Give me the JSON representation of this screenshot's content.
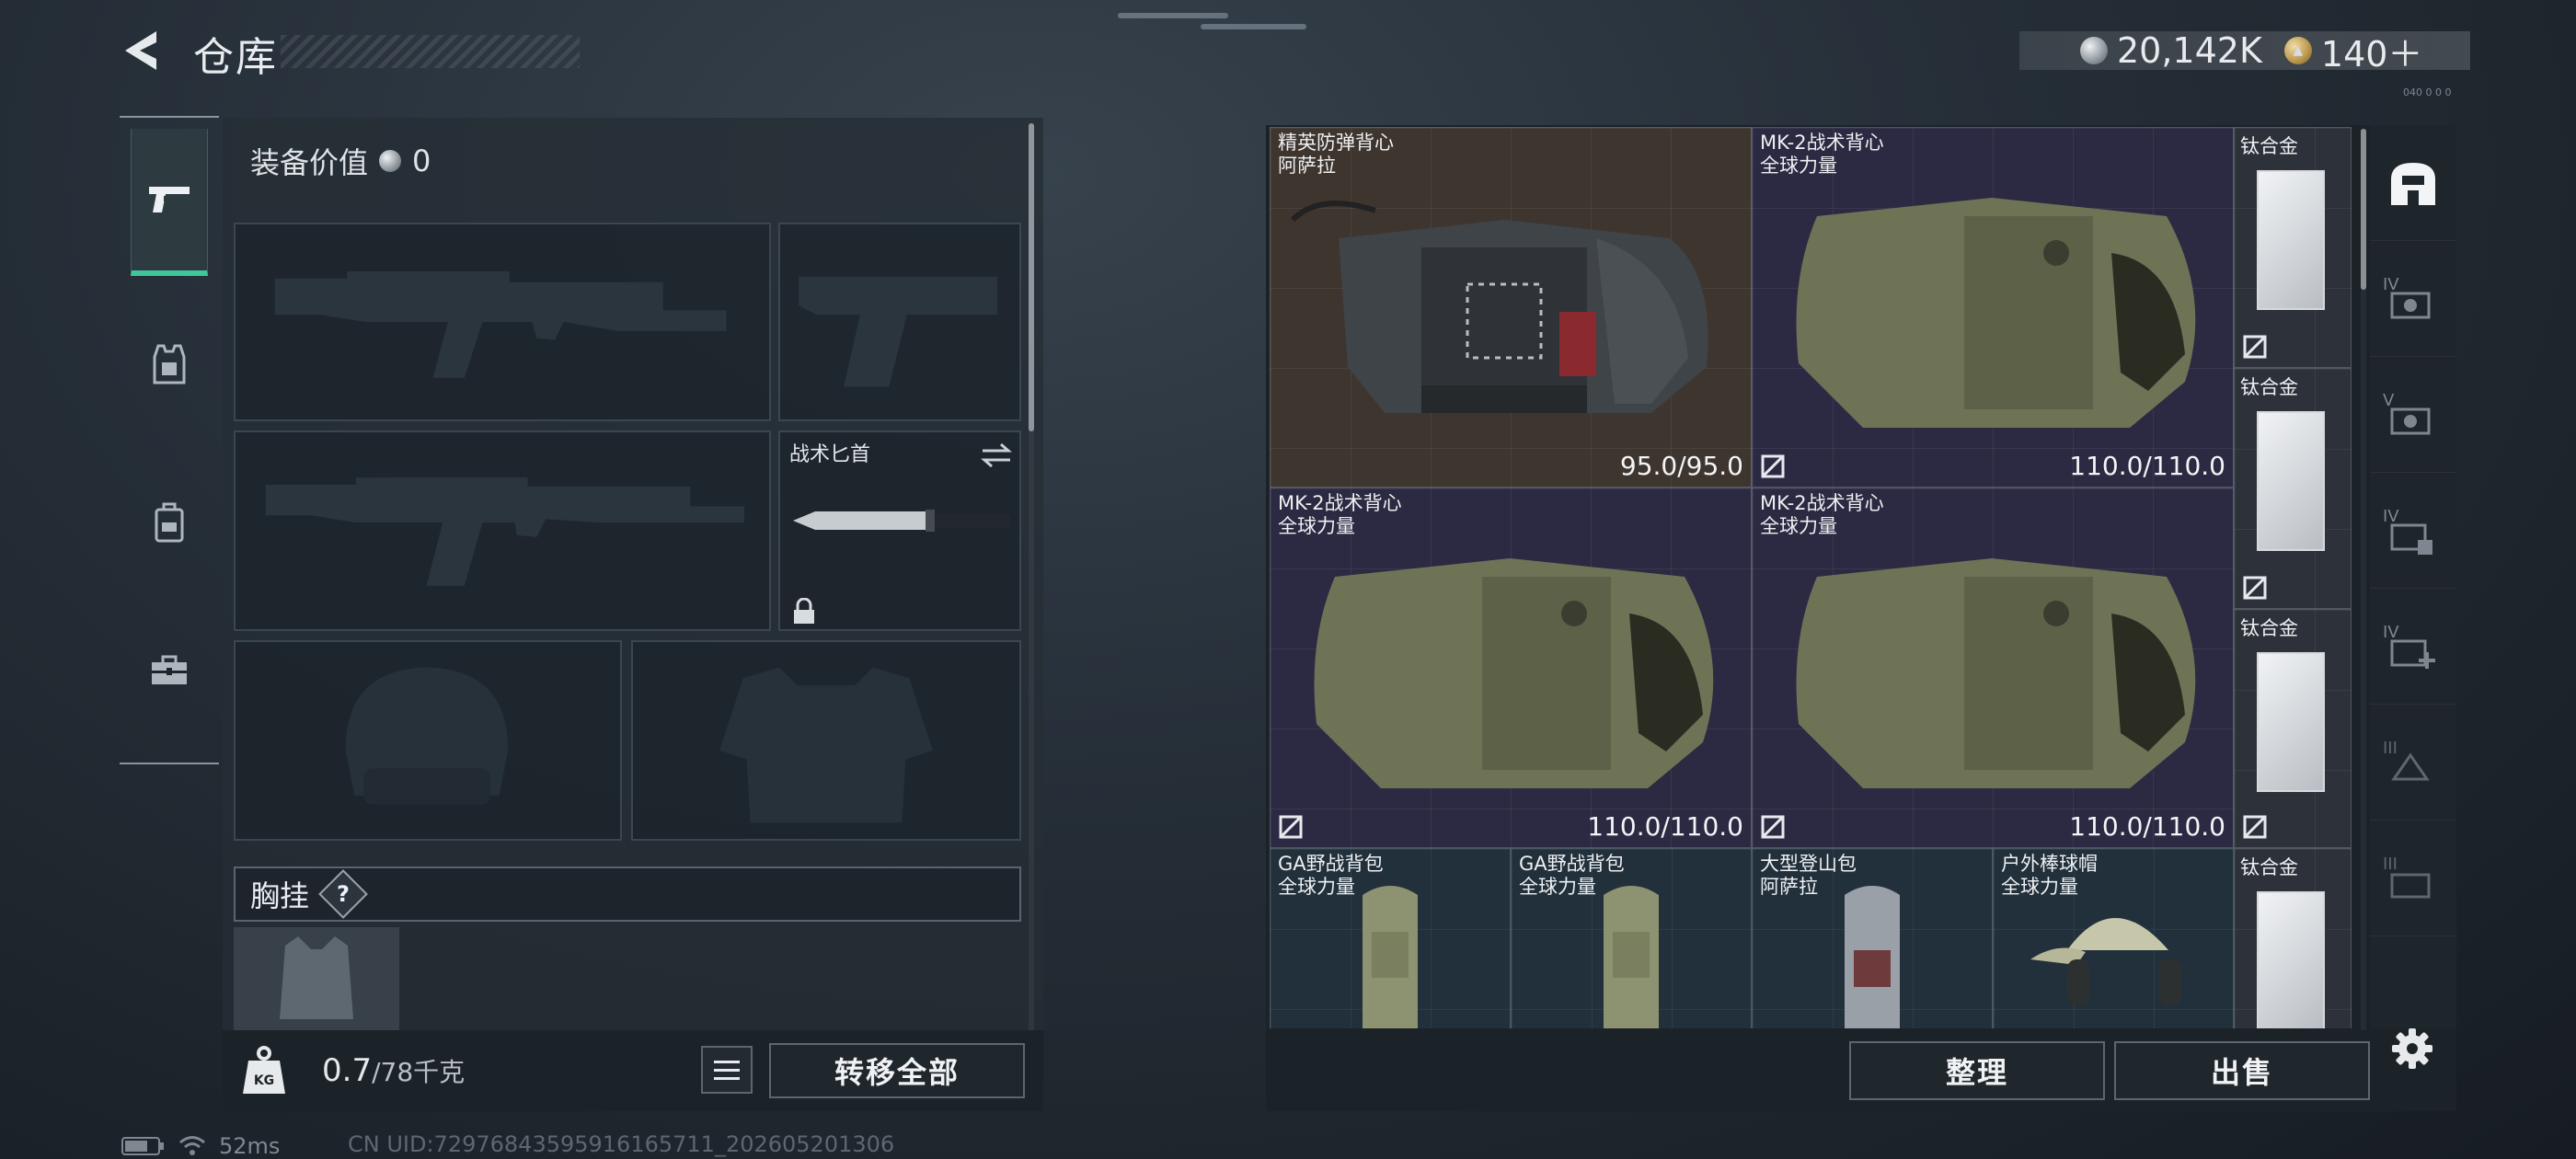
{
  "header": {
    "title": "仓库",
    "currency_coins": "20,142K",
    "currency_tokens": "140＋",
    "corner_text": "040 0 0 0"
  },
  "left": {
    "equipment_value_label": "装备价值",
    "equipment_value": "0",
    "knife_label": "战术匕首",
    "chest_label": "胸挂",
    "chest_help": "?",
    "weight_value": "0.7",
    "weight_cap": "/78千克",
    "transfer_all": "转移全部"
  },
  "tabs": [
    {
      "icon": "pistol-icon",
      "active": true
    },
    {
      "icon": "armor-vest-icon",
      "active": false
    },
    {
      "icon": "backpack-icon",
      "active": false
    },
    {
      "icon": "toolbox-icon",
      "active": false
    }
  ],
  "inventory": {
    "items": [
      {
        "name": "精英防弹背心",
        "brand": "阿萨拉",
        "durability": "95.0/95.0",
        "color": "brown"
      },
      {
        "name": "MK-2战术背心",
        "brand": "全球力量",
        "durability": "110.0/110.0",
        "color": "purple"
      },
      {
        "name": "MK-2战术背心",
        "brand": "全球力量",
        "durability": "110.0/110.0",
        "color": "purple"
      },
      {
        "name": "MK-2战术背心",
        "brand": "全球力量",
        "durability": "110.0/110.0",
        "color": "purple"
      },
      {
        "name": "GA野战背包",
        "brand": "全球力量",
        "color": "blue"
      },
      {
        "name": "GA野战背包",
        "brand": "全球力量",
        "color": "blue"
      },
      {
        "name": "大型登山包",
        "brand": "阿萨拉",
        "color": "blue"
      },
      {
        "name": "户外棒球帽",
        "brand": "全球力量",
        "color": "blue"
      }
    ],
    "titanium_label": "钛合金",
    "sort_button": "整理",
    "sell_button": "出售"
  },
  "filters": [
    {
      "icon": "all-items-icon",
      "level": ""
    },
    {
      "icon": "armor-filter-icon",
      "level": "IV"
    },
    {
      "icon": "armor-filter-icon",
      "level": "V"
    },
    {
      "icon": "helmet-filter-icon",
      "level": "IV"
    },
    {
      "icon": "medkit-filter-icon",
      "level": "IV"
    },
    {
      "icon": "ammo-filter-icon",
      "level": "III"
    },
    {
      "icon": "misc-filter-icon",
      "level": "III"
    }
  ],
  "status": {
    "ping": "52ms",
    "uid": "CN UID:72976843595916165711_202605201306"
  }
}
